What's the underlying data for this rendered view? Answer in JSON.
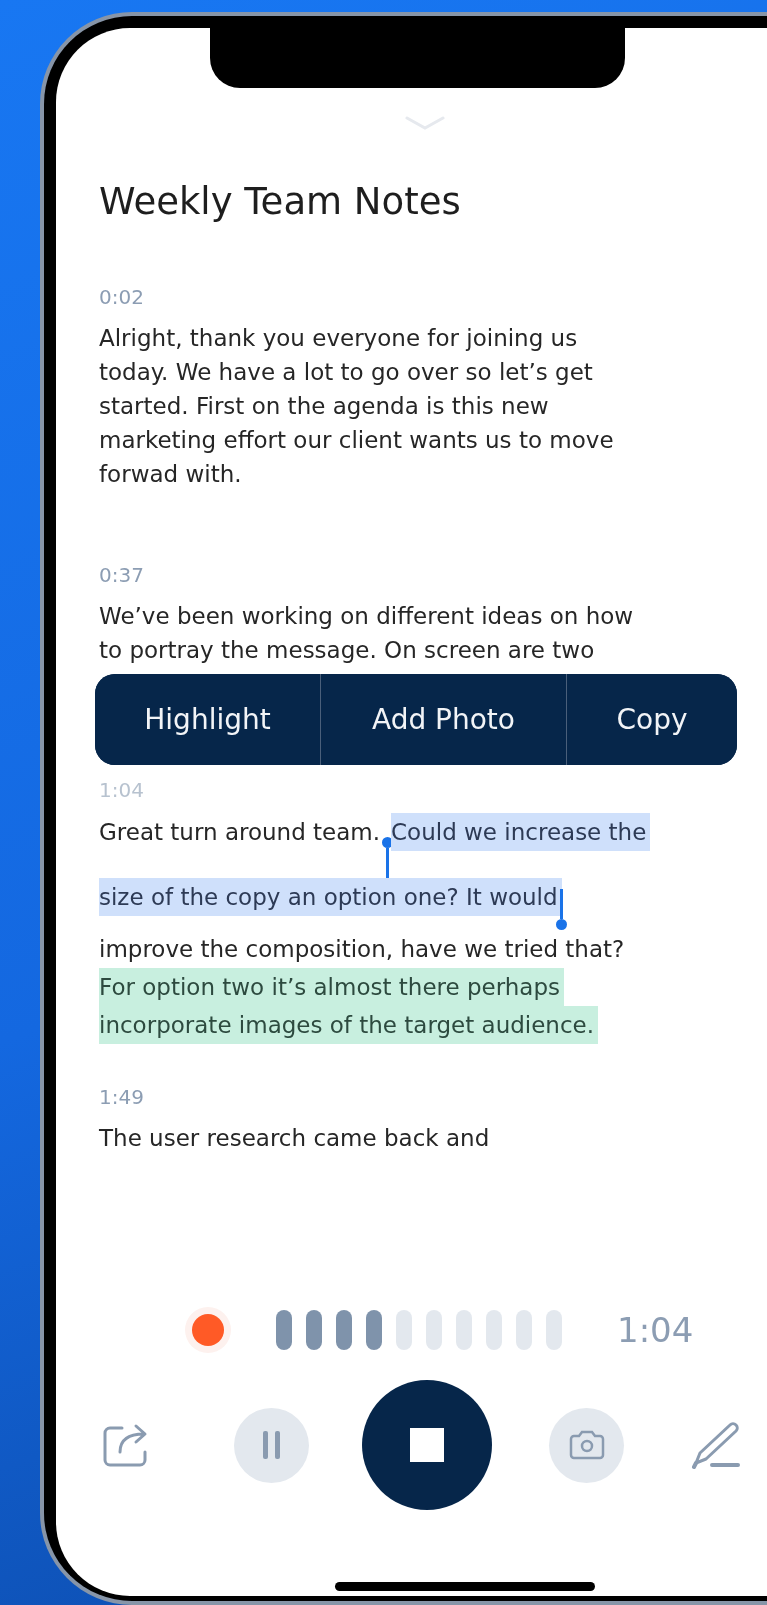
{
  "note": {
    "title": "Weekly Team Notes"
  },
  "segments": [
    {
      "time": "0:02",
      "lines": [
        [
          {
            "text": "Alright, thank you everyone for joining us",
            "kind": "plain"
          }
        ],
        [
          {
            "text": "today. We have a lot to go over so let’s get",
            "kind": "plain"
          }
        ],
        [
          {
            "text": "started. First on the agenda is this new",
            "kind": "plain"
          }
        ],
        [
          {
            "text": "marketing effort our client wants us to move",
            "kind": "plain"
          }
        ],
        [
          {
            "text": "forwad with.",
            "kind": "plain"
          }
        ]
      ]
    },
    {
      "time": "0:37",
      "lines": [
        [
          {
            "text": "We’ve been working on different ideas on how",
            "kind": "plain"
          }
        ],
        [
          {
            "text": "to portray the message. On screen are two",
            "kind": "plain"
          }
        ]
      ]
    },
    {
      "time": "1:04",
      "lines": [
        [
          {
            "text": "Great turn around team.",
            "kind": "plain"
          },
          {
            "text": "Could we increase the",
            "kind": "selected"
          }
        ],
        [
          {
            "text": "size of the copy an option one? It would",
            "kind": "selected"
          }
        ],
        [
          {
            "text": "improve the composition, have we tried that?",
            "kind": "plain"
          }
        ],
        [
          {
            "text": "For option two it’s almost there perhaps",
            "kind": "highlight"
          }
        ],
        [
          {
            "text": "incorporate images of the target audience.",
            "kind": "highlight"
          }
        ]
      ]
    },
    {
      "time": "1:49",
      "lines": [
        [
          {
            "text": "The user research came back and",
            "kind": "plain"
          }
        ]
      ]
    }
  ],
  "context_menu": {
    "items": [
      {
        "label": "Highlight"
      },
      {
        "label": "Add Photo"
      },
      {
        "label": "Copy"
      }
    ]
  },
  "recorder": {
    "recording": true,
    "level": 0.4,
    "elapsed": "1:04",
    "paused": false
  }
}
